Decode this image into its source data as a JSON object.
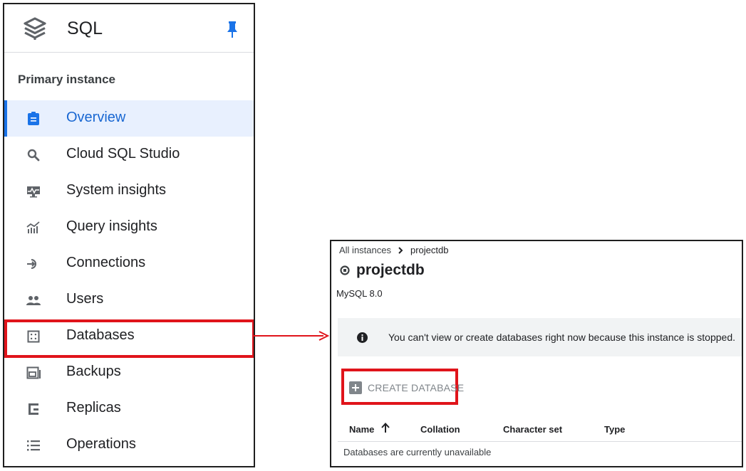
{
  "nav": {
    "product_title": "SQL",
    "section_label": "Primary instance",
    "items": [
      {
        "label": "Overview",
        "icon": "overview-icon",
        "active": true
      },
      {
        "label": "Cloud SQL Studio",
        "icon": "search-icon"
      },
      {
        "label": "System insights",
        "icon": "monitor-icon"
      },
      {
        "label": "Query insights",
        "icon": "chart-icon"
      },
      {
        "label": "Connections",
        "icon": "connection-icon"
      },
      {
        "label": "Users",
        "icon": "users-icon"
      },
      {
        "label": "Databases",
        "icon": "database-icon",
        "highlighted": true
      },
      {
        "label": "Backups",
        "icon": "backup-icon"
      },
      {
        "label": "Replicas",
        "icon": "replica-icon"
      },
      {
        "label": "Operations",
        "icon": "list-icon"
      }
    ]
  },
  "detail": {
    "breadcrumb": {
      "root": "All instances",
      "current": "projectdb"
    },
    "instance_name": "projectdb",
    "db_version": "MySQL 8.0",
    "banner_text": "You can't view or create databases right now because this instance is stopped.",
    "create_button_label": "CREATE DATABASE",
    "table": {
      "columns": [
        "Name",
        "Collation",
        "Character set",
        "Type"
      ],
      "empty_message": "Databases are currently unavailable"
    }
  },
  "colors": {
    "accent": "#1a73e8",
    "active_background": "#e8f0fe",
    "highlight": "#e0141b",
    "banner_background": "#f1f3f4"
  }
}
